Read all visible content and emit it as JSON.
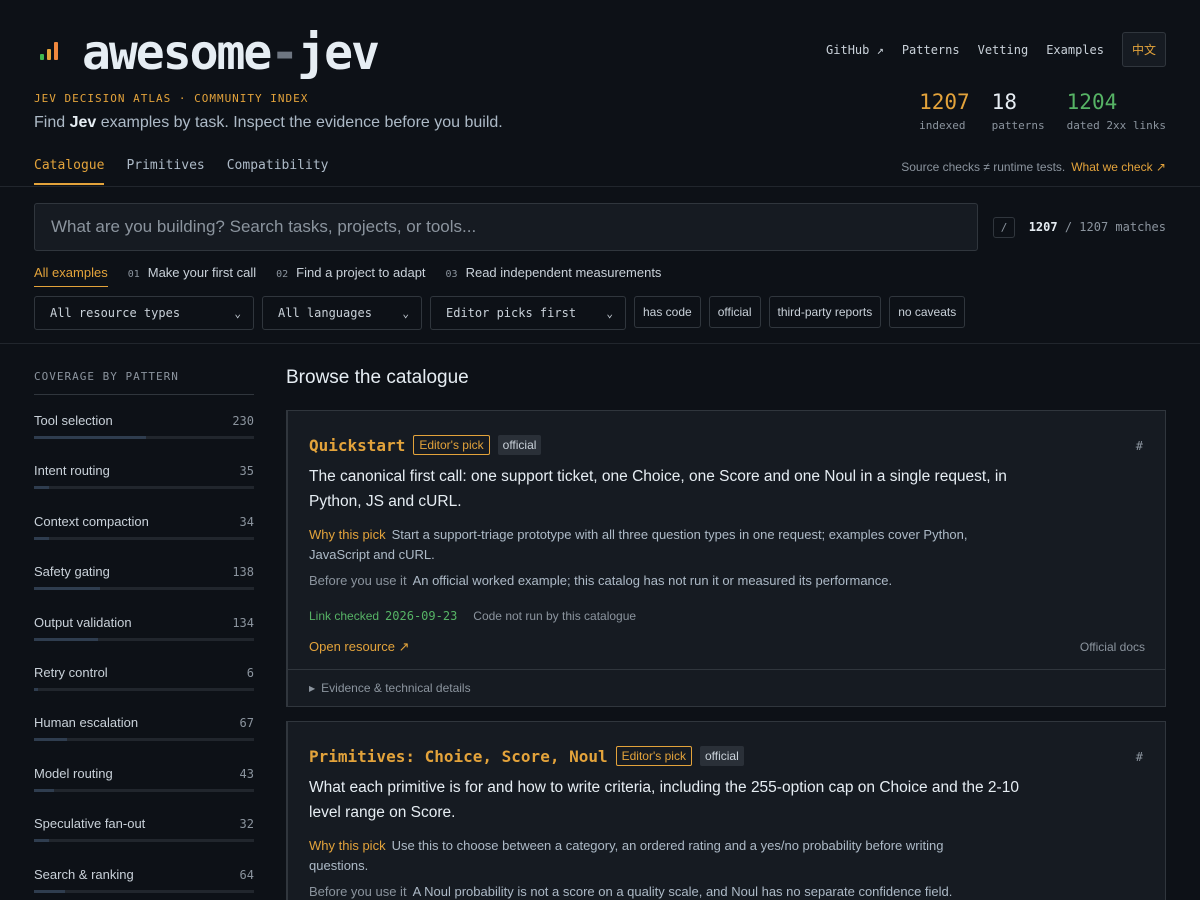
{
  "header": {
    "title_part1": "awesome",
    "title_dash": "-",
    "title_part2": "jev",
    "tagline": "JEV DECISION ATLAS · COMMUNITY INDEX",
    "subtitle_pre": "Find ",
    "subtitle_bold": "Jev",
    "subtitle_post": " examples by task. Inspect the evidence before you build.",
    "logo_colors": [
      "#3fb950",
      "#e3a33b",
      "#f0883e"
    ]
  },
  "topnav": {
    "items": [
      "GitHub ↗",
      "Patterns",
      "Vetting",
      "Examples"
    ],
    "lang_button": "中文"
  },
  "stats": [
    {
      "value": "1207",
      "label": "indexed",
      "color": "#e3a33b"
    },
    {
      "value": "18",
      "label": "patterns",
      "color": "#e6edf3"
    },
    {
      "value": "1204",
      "label": "dated 2xx links",
      "color": "#56b365"
    }
  ],
  "tabs": [
    "Catalogue",
    "Primitives",
    "Compatibility"
  ],
  "source_note": {
    "text": "Source checks ≠ runtime tests.",
    "link": "What we check ↗"
  },
  "search": {
    "placeholder": "What are you building? Search tasks, projects, or tools...",
    "shortcut": "/",
    "match_count": "1207",
    "match_total": "/ 1207 matches"
  },
  "tasks": [
    {
      "num": "",
      "label": "All examples"
    },
    {
      "num": "01",
      "label": "Make your first call"
    },
    {
      "num": "02",
      "label": "Find a project to adapt"
    },
    {
      "num": "03",
      "label": "Read independent measurements"
    }
  ],
  "filters": {
    "selects": [
      "All resource types",
      "All languages",
      "Editor picks first"
    ],
    "chips": [
      "has code",
      "official",
      "third-party reports",
      "no caveats"
    ]
  },
  "sidebar": {
    "title": "COVERAGE BY PATTERN",
    "items": [
      {
        "name": "Tool selection",
        "count": "230",
        "fill": 0.51
      },
      {
        "name": "Intent routing",
        "count": "35",
        "fill": 0.07
      },
      {
        "name": "Context compaction",
        "count": "34",
        "fill": 0.07
      },
      {
        "name": "Safety gating",
        "count": "138",
        "fill": 0.3
      },
      {
        "name": "Output validation",
        "count": "134",
        "fill": 0.29
      },
      {
        "name": "Retry control",
        "count": "6",
        "fill": 0.02
      },
      {
        "name": "Human escalation",
        "count": "67",
        "fill": 0.15
      },
      {
        "name": "Model routing",
        "count": "43",
        "fill": 0.09
      },
      {
        "name": "Speculative fan-out",
        "count": "32",
        "fill": 0.07
      },
      {
        "name": "Search & ranking",
        "count": "64",
        "fill": 0.14
      }
    ]
  },
  "main": {
    "heading": "Browse the catalogue",
    "cards": [
      {
        "title": "Quickstart",
        "pick_badge": "Editor's pick",
        "official_badge": "official",
        "hash": "#",
        "description": "The canonical first call: one support ticket, one Choice, one Score and one Noul in a single request, in Python, JS and cURL.",
        "why_label": "Why this pick",
        "why_text": "Start a support-triage prototype with all three question types in one request; examples cover Python, JavaScript and cURL.",
        "before_label": "Before you use it",
        "before_text": "An official worked example; this catalog has not run it or measured its performance.",
        "link_checked_label": "Link checked",
        "link_checked_date": "2026-09-23",
        "code_note": "Code not run by this catalogue",
        "open_label": "Open resource ↗",
        "source": "Official docs",
        "evidence": "Evidence & technical details"
      },
      {
        "title": "Primitives: Choice, Score, Noul",
        "pick_badge": "Editor's pick",
        "official_badge": "official",
        "hash": "#",
        "description": "What each primitive is for and how to write criteria, including the 255-option cap on Choice and the 2-10 level range on Score.",
        "why_label": "Why this pick",
        "why_text": "Use this to choose between a category, an ordered rating and a yes/no probability before writing questions.",
        "before_label": "Before you use it",
        "before_text": "A Noul probability is not a score on a quality scale, and Noul has no separate confidence field."
      }
    ]
  }
}
